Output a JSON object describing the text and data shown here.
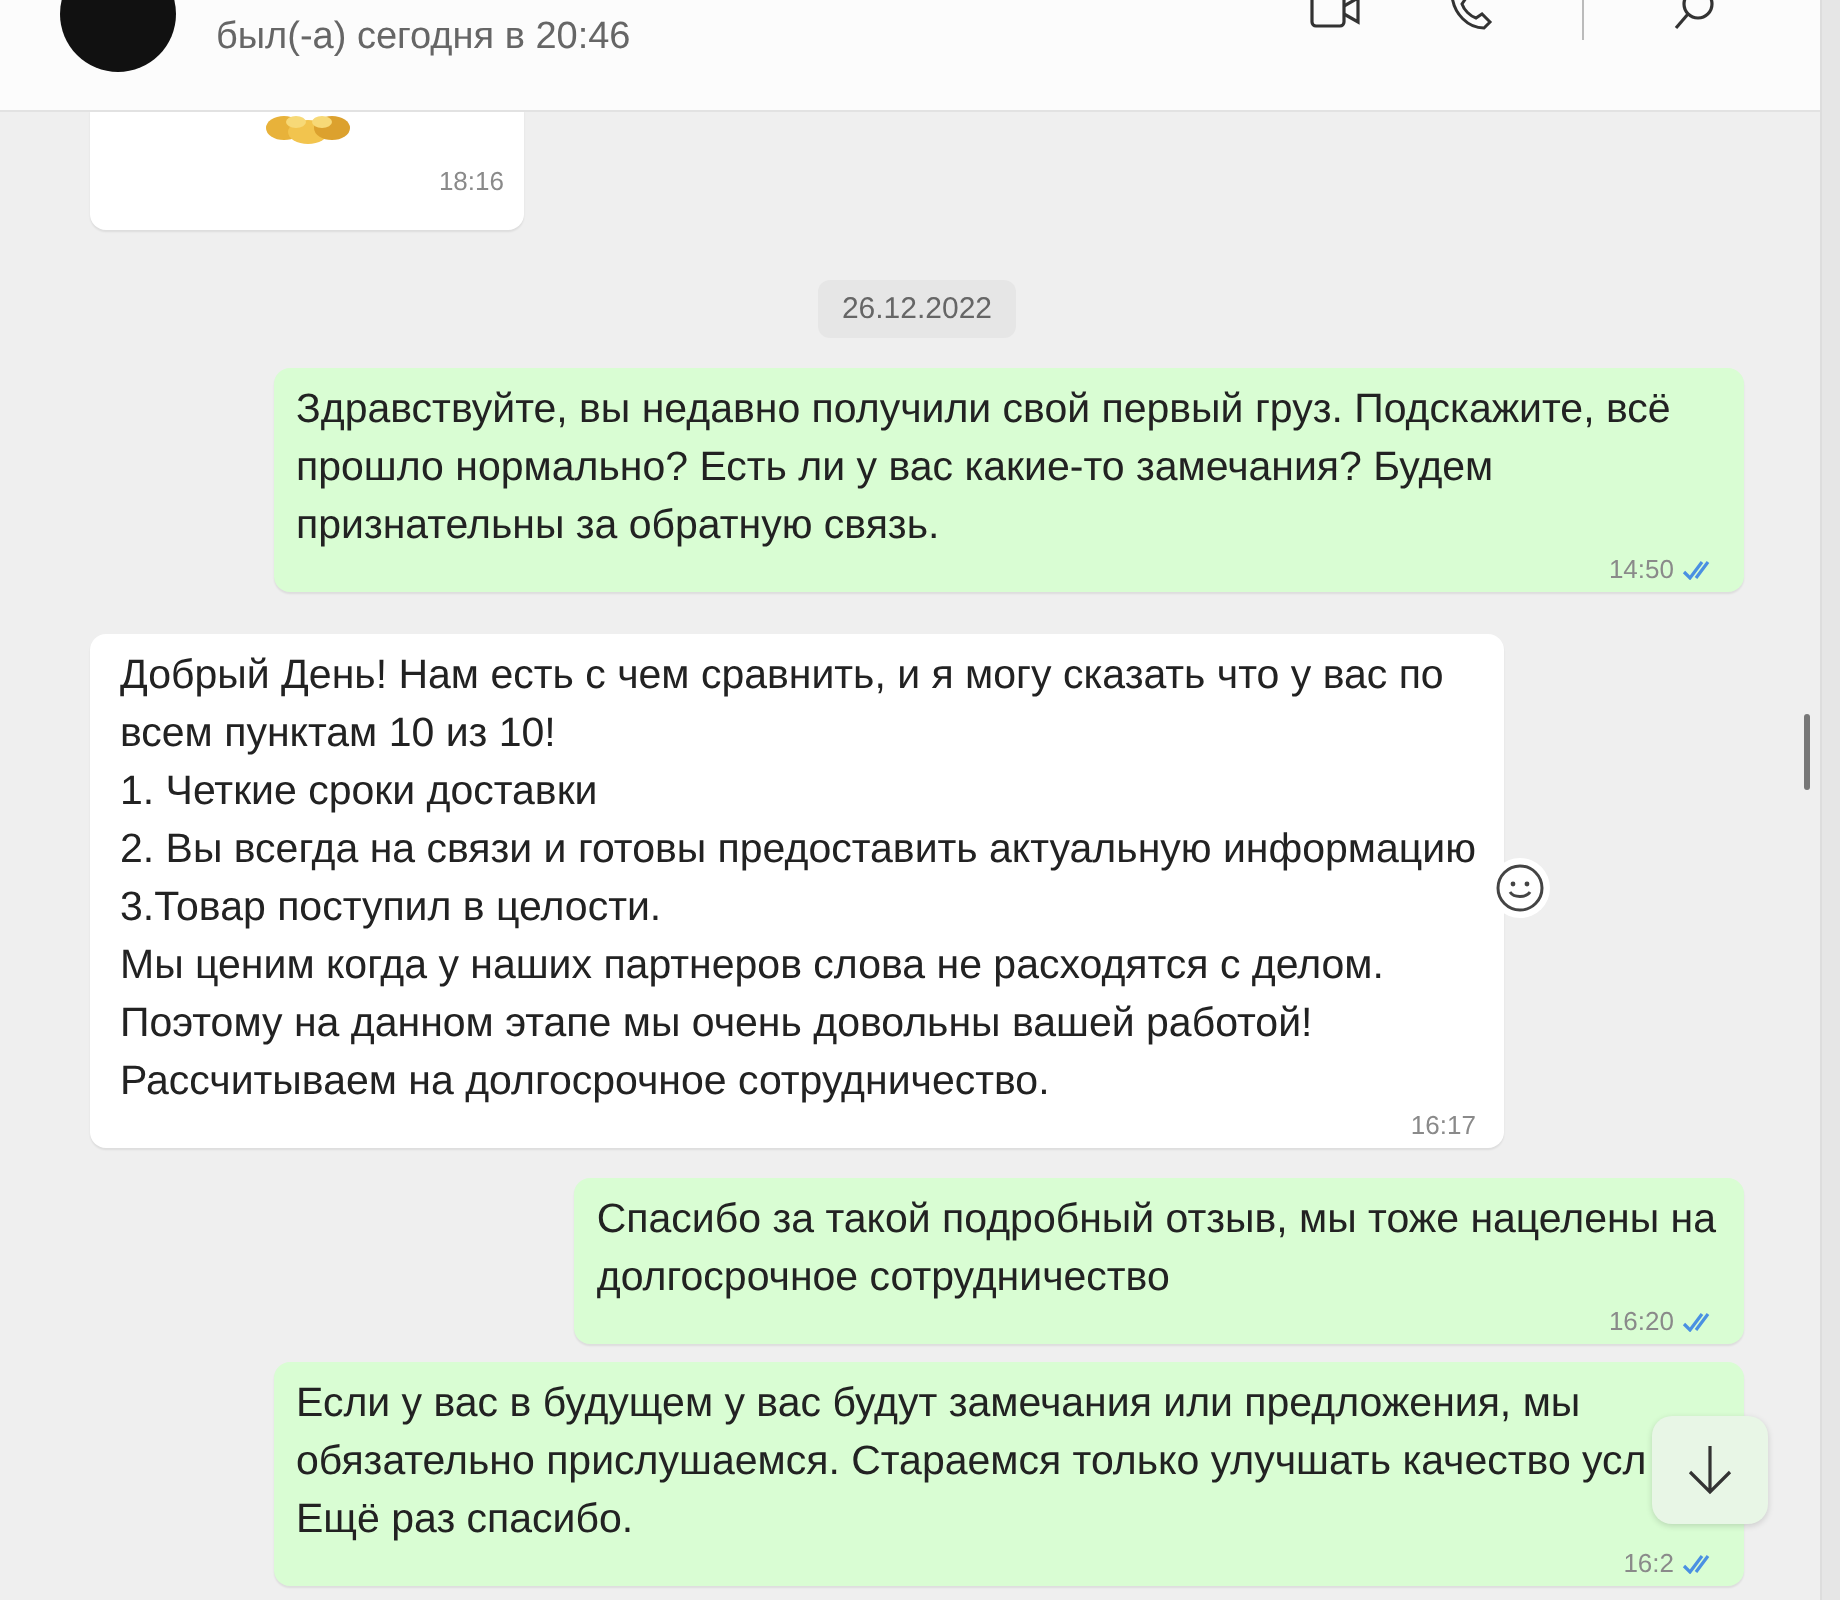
{
  "header": {
    "status": "был(-а) сегодня в 20:46"
  },
  "messages": [
    {
      "time": "18:16"
    },
    {
      "kind": "date",
      "text": "26.12.2022"
    },
    {
      "kind": "outgoing",
      "lines": [
        "Здравствуйте, вы недавно получили свой первый груз. Подскажите, всё",
        "прошло нормально? Есть ли у вас какие-то замечания? Будем",
        "признательны за обратную связь."
      ],
      "time": "14:50",
      "read": true
    },
    {
      "kind": "incoming",
      "lines": [
        "Добрый День! Нам есть с чем сравнить, и я могу сказать что у вас по",
        "всем пунктам 10 из 10!",
        "1. Четкие сроки доставки",
        "2. Вы всегда на связи и готовы предоставить актуальную информацию",
        "3.Товар поступил в целости.",
        "Мы ценим когда у наших партнеров слова не расходятся с делом.",
        "Поэтому на данном этапе мы очень довольны вашей работой!",
        "Рассчитываем на долгосрочное сотрудничество."
      ],
      "time": "16:17"
    },
    {
      "kind": "outgoing",
      "lines": [
        "Спасибо за такой подробный отзыв, мы тоже нацелены на",
        "долгосрочное сотрудничество"
      ],
      "time": "16:20",
      "read": true
    },
    {
      "kind": "outgoing",
      "lines": [
        "Если у вас в будущем у вас будут замечания или предложения, мы",
        "обязательно прислушаемся. Стараемся только улучшать качество усл",
        "Ещё раз спасибо."
      ],
      "time": "16:2",
      "read": true
    }
  ]
}
